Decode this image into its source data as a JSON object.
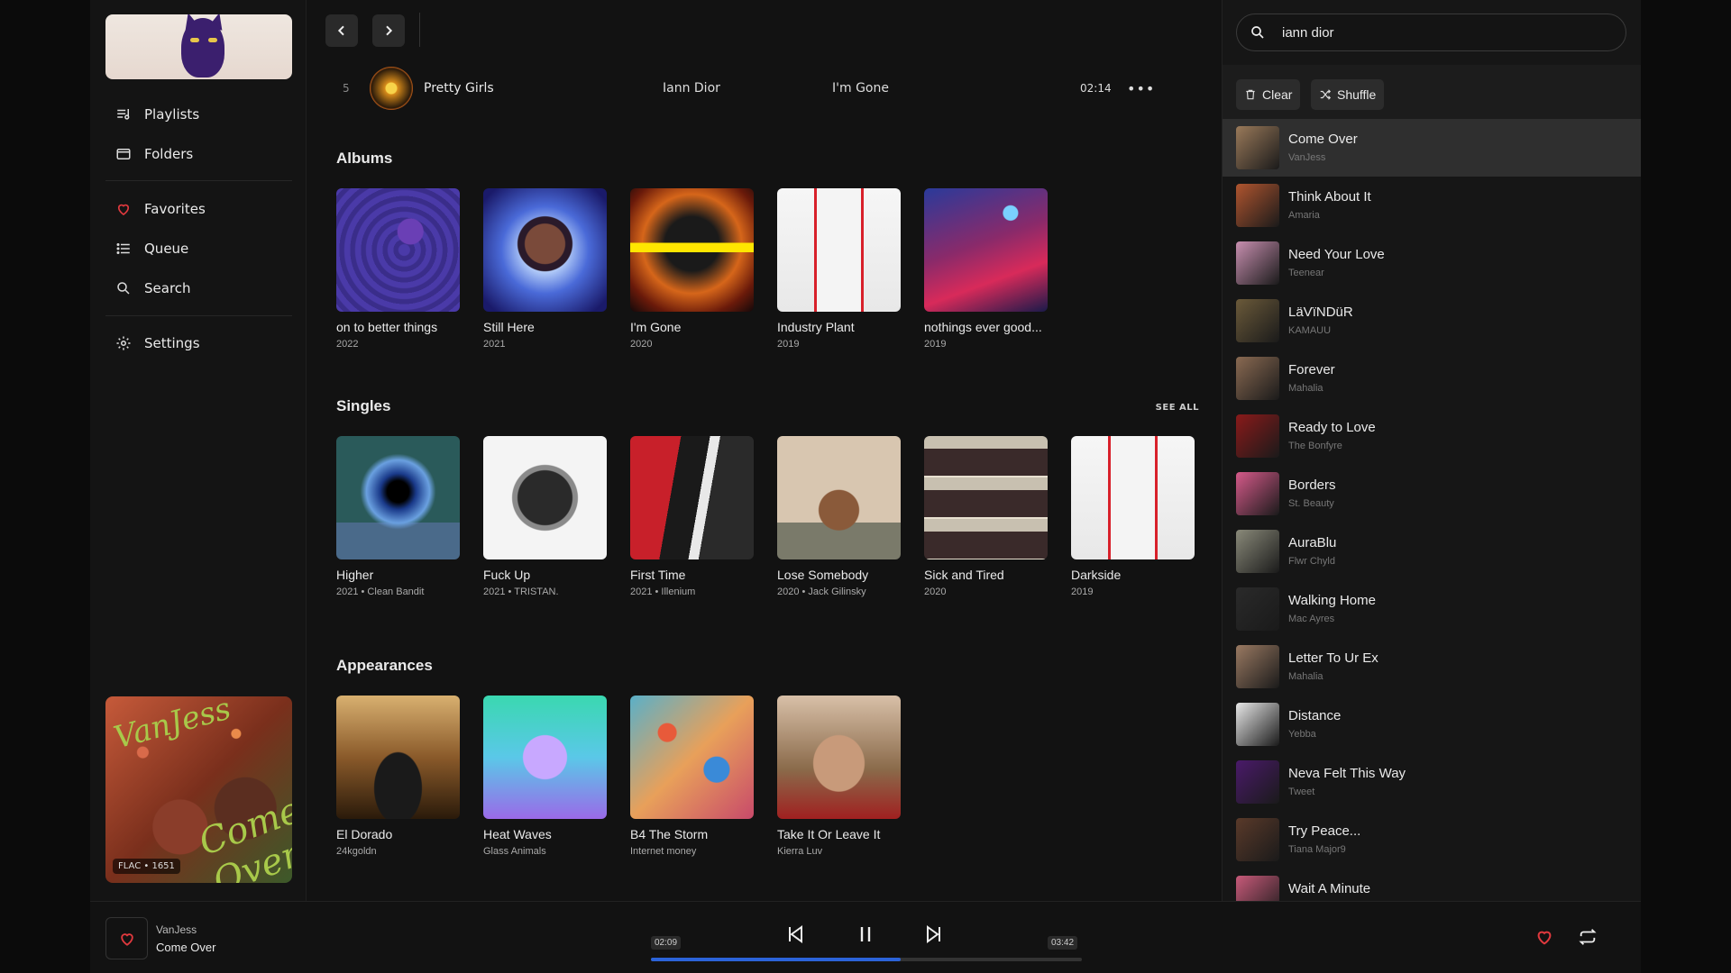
{
  "sidebar": {
    "nav": [
      {
        "label": "Playlists",
        "icon": "playlist-icon"
      },
      {
        "label": "Folders",
        "icon": "folder-icon"
      },
      {
        "label": "Favorites",
        "icon": "heart-icon"
      },
      {
        "label": "Queue",
        "icon": "list-icon"
      },
      {
        "label": "Search",
        "icon": "search-icon"
      },
      {
        "label": "Settings",
        "icon": "gear-icon"
      }
    ],
    "now_playing_badge": "FLAC • 1651",
    "now_playing_art_text": [
      "VanJess",
      "Come Over"
    ]
  },
  "track_row": {
    "number": "5",
    "title": "Pretty Girls",
    "artist": "Iann Dior",
    "album": "I'm Gone",
    "duration": "02:14",
    "more": "•••"
  },
  "sections": {
    "albums_title": "Albums",
    "singles_title": "Singles",
    "singles_see_all": "SEE ALL",
    "appearances_title": "Appearances"
  },
  "albums": [
    {
      "title": "on to better things",
      "sub": "2022"
    },
    {
      "title": "Still Here",
      "sub": "2021"
    },
    {
      "title": "I'm Gone",
      "sub": "2020"
    },
    {
      "title": "Industry Plant",
      "sub": "2019"
    },
    {
      "title": "nothings ever good...",
      "sub": "2019"
    }
  ],
  "singles": [
    {
      "title": "Higher",
      "sub": "2021 • Clean Bandit"
    },
    {
      "title": "Fuck Up",
      "sub": "2021 • TRISTAN."
    },
    {
      "title": "First Time",
      "sub": "2021 • Illenium"
    },
    {
      "title": "Lose Somebody",
      "sub": "2020 • Jack Gilinsky"
    },
    {
      "title": "Sick and Tired",
      "sub": "2020"
    },
    {
      "title": "Darkside",
      "sub": "2019"
    }
  ],
  "appearances": [
    {
      "title": "El Dorado",
      "sub": "24kgoldn"
    },
    {
      "title": "Heat Waves",
      "sub": "Glass Animals"
    },
    {
      "title": "B4 The Storm",
      "sub": "Internet money"
    },
    {
      "title": "Take It Or Leave It",
      "sub": "Kierra Luv"
    }
  ],
  "queue": {
    "search_value": "iann dior",
    "clear_label": "Clear",
    "shuffle_label": "Shuffle",
    "items": [
      {
        "title": "Come Over",
        "artist": "VanJess",
        "color": "#9a7a5a"
      },
      {
        "title": "Think About It",
        "artist": "Amaria",
        "color": "#b0552f"
      },
      {
        "title": "Need Your Love",
        "artist": "Teenear",
        "color": "#c88fb0"
      },
      {
        "title": "LäVïNDüR",
        "artist": "KAMAUU",
        "color": "#6b5a3a"
      },
      {
        "title": "Forever",
        "artist": "Mahalia",
        "color": "#8a6a52"
      },
      {
        "title": "Ready to Love",
        "artist": "The Bonfyre",
        "color": "#8a1a1a"
      },
      {
        "title": "Borders",
        "artist": "St. Beauty",
        "color": "#d65a8a"
      },
      {
        "title": "AuraBlu",
        "artist": "Flwr Chyld",
        "color": "#8a8a7a"
      },
      {
        "title": "Walking Home",
        "artist": "Mac Ayres",
        "color": "#2a2a2a"
      },
      {
        "title": "Letter To Ur Ex",
        "artist": "Mahalia",
        "color": "#9a7a62"
      },
      {
        "title": "Distance",
        "artist": "Yebba",
        "color": "#e8e8e8"
      },
      {
        "title": "Neva Felt This Way",
        "artist": "Tweet",
        "color": "#4a1a6a"
      },
      {
        "title": "Try Peace...",
        "artist": "Tiana Major9",
        "color": "#5a3a2a"
      },
      {
        "title": "Wait A Minute",
        "artist": "",
        "color": "#c85a7a"
      }
    ]
  },
  "player": {
    "artist": "VanJess",
    "title": "Come Over",
    "elapsed": "02:09",
    "total": "03:42",
    "progress": 0.58
  },
  "colors": {
    "accent": "#2b63d9",
    "heart": "#e0393e"
  }
}
